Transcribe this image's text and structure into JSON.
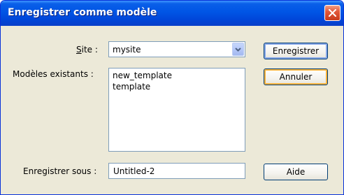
{
  "window": {
    "title": "Enregistrer comme modèle"
  },
  "form": {
    "site_label_char": "S",
    "site_label_rest": "ite :",
    "site_value": "mysite",
    "templates_label": "Modèles existants :",
    "templates": [
      "new_template",
      "template"
    ],
    "save_as_label": "Enregistrer sous :",
    "save_as_value": "Untitled-2"
  },
  "buttons": {
    "save": "Enregistrer",
    "cancel": "Annuler",
    "help": "Aide"
  },
  "colors": {
    "titlebar": "#0055e5",
    "close": "#e2583a",
    "dialog_bg": "#ece9d8",
    "focus_ring": "#f8b33c"
  },
  "icons": {
    "close": "close-icon",
    "dropdown": "chevron-down-icon"
  }
}
